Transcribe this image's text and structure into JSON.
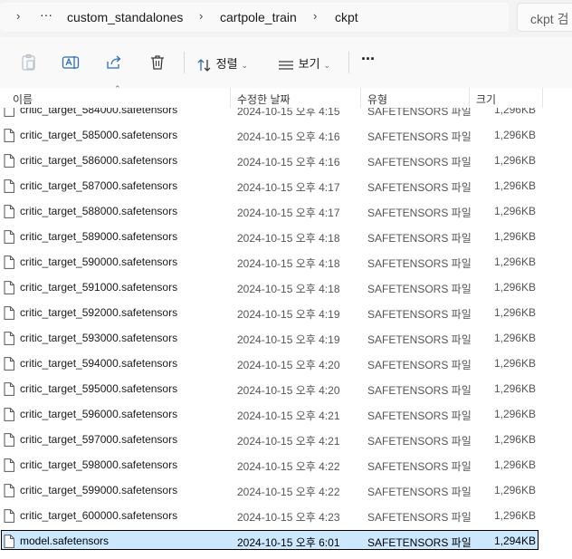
{
  "address": {
    "crumbs": [
      "custom_standalones",
      "cartpole_train",
      "ckpt"
    ],
    "overflow": "···",
    "separator": "›",
    "search_placeholder": "ckpt 검"
  },
  "toolbar": {
    "sort_label": "정렬",
    "view_label": "보기",
    "more_label": "···",
    "icons": [
      "paste-icon",
      "rename-icon",
      "share-icon",
      "delete-icon",
      "sort-icon",
      "view-icon",
      "more-icon"
    ]
  },
  "columns": {
    "name": "이름",
    "modified": "수정한 날짜",
    "type": "유형",
    "size": "크기"
  },
  "files": [
    {
      "name": "critic_target_584000.safetensors",
      "date": "2024-10-15 오후 4:15",
      "type": "SAFETENSORS 파일",
      "size": "1,296KB"
    },
    {
      "name": "critic_target_585000.safetensors",
      "date": "2024-10-15 오후 4:16",
      "type": "SAFETENSORS 파일",
      "size": "1,296KB"
    },
    {
      "name": "critic_target_586000.safetensors",
      "date": "2024-10-15 오후 4:16",
      "type": "SAFETENSORS 파일",
      "size": "1,296KB"
    },
    {
      "name": "critic_target_587000.safetensors",
      "date": "2024-10-15 오후 4:17",
      "type": "SAFETENSORS 파일",
      "size": "1,296KB"
    },
    {
      "name": "critic_target_588000.safetensors",
      "date": "2024-10-15 오후 4:17",
      "type": "SAFETENSORS 파일",
      "size": "1,296KB"
    },
    {
      "name": "critic_target_589000.safetensors",
      "date": "2024-10-15 오후 4:18",
      "type": "SAFETENSORS 파일",
      "size": "1,296KB"
    },
    {
      "name": "critic_target_590000.safetensors",
      "date": "2024-10-15 오후 4:18",
      "type": "SAFETENSORS 파일",
      "size": "1,296KB"
    },
    {
      "name": "critic_target_591000.safetensors",
      "date": "2024-10-15 오후 4:18",
      "type": "SAFETENSORS 파일",
      "size": "1,296KB"
    },
    {
      "name": "critic_target_592000.safetensors",
      "date": "2024-10-15 오후 4:19",
      "type": "SAFETENSORS 파일",
      "size": "1,296KB"
    },
    {
      "name": "critic_target_593000.safetensors",
      "date": "2024-10-15 오후 4:19",
      "type": "SAFETENSORS 파일",
      "size": "1,296KB"
    },
    {
      "name": "critic_target_594000.safetensors",
      "date": "2024-10-15 오후 4:20",
      "type": "SAFETENSORS 파일",
      "size": "1,296KB"
    },
    {
      "name": "critic_target_595000.safetensors",
      "date": "2024-10-15 오후 4:20",
      "type": "SAFETENSORS 파일",
      "size": "1,296KB"
    },
    {
      "name": "critic_target_596000.safetensors",
      "date": "2024-10-15 오후 4:21",
      "type": "SAFETENSORS 파일",
      "size": "1,296KB"
    },
    {
      "name": "critic_target_597000.safetensors",
      "date": "2024-10-15 오후 4:21",
      "type": "SAFETENSORS 파일",
      "size": "1,296KB"
    },
    {
      "name": "critic_target_598000.safetensors",
      "date": "2024-10-15 오후 4:22",
      "type": "SAFETENSORS 파일",
      "size": "1,296KB"
    },
    {
      "name": "critic_target_599000.safetensors",
      "date": "2024-10-15 오후 4:22",
      "type": "SAFETENSORS 파일",
      "size": "1,296KB"
    },
    {
      "name": "critic_target_600000.safetensors",
      "date": "2024-10-15 오후 4:23",
      "type": "SAFETENSORS 파일",
      "size": "1,296KB"
    },
    {
      "name": "model.safetensors",
      "date": "2024-10-15 오후 6:01",
      "type": "SAFETENSORS 파일",
      "size": "1,294KB",
      "selected": true
    }
  ],
  "colors": {
    "selection_bg": "#cce8ff",
    "selection_border": "#000000",
    "toolbar_bg": "#f9f9f9"
  }
}
